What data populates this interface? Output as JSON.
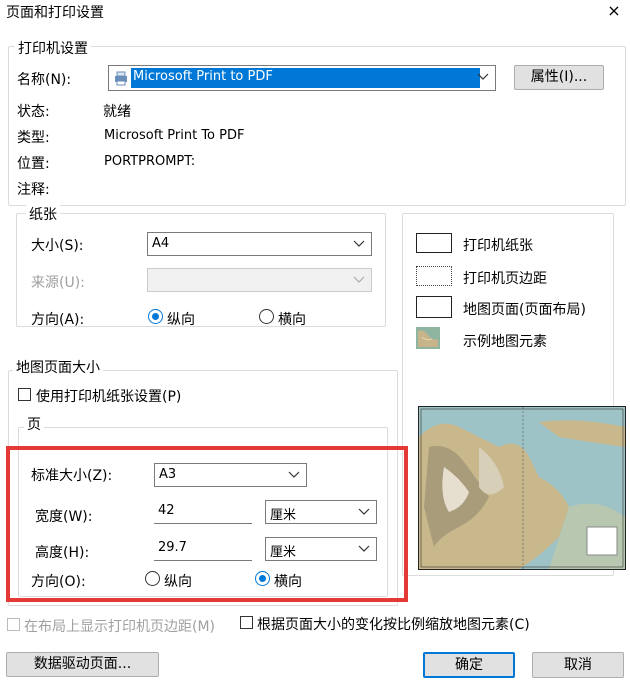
{
  "window": {
    "title": "页面和打印设置",
    "close_glyph": "×"
  },
  "printer": {
    "group_label": "打印机设置",
    "name_label": "名称(N):",
    "name_value": "Microsoft Print to PDF",
    "properties_button": "属性(I)...",
    "status_label": "状态:",
    "status_value": "就绪",
    "type_label": "类型:",
    "type_value": "Microsoft Print To PDF",
    "location_label": "位置:",
    "location_value": "PORTPROMPT:",
    "comment_label": "注释:"
  },
  "paper": {
    "group_label": "纸张",
    "size_label": "大小(S):",
    "size_value": "A4",
    "source_label": "来源(U):",
    "source_value": "",
    "orientation_label": "方向(A):",
    "portrait_label": "纵向",
    "landscape_label": "横向",
    "orientation_selected": "portrait"
  },
  "legend": {
    "items": [
      {
        "label": "打印机纸张",
        "style": "solid"
      },
      {
        "label": "打印机页边距",
        "style": "dotted"
      },
      {
        "label": "地图页面(页面布局)",
        "style": "solid"
      },
      {
        "label": "示例地图元素",
        "style": "map"
      }
    ]
  },
  "map_page": {
    "group_label": "地图页面大小",
    "use_printer_paper_label": "使用打印机纸张设置(P)",
    "use_printer_paper_checked": false,
    "page_group_label": "页",
    "standard_size_label": "标准大小(Z):",
    "standard_size_value": "A3",
    "width_label": "宽度(W):",
    "width_value": "42",
    "width_unit": "厘米",
    "height_label": "高度(H):",
    "height_value": "29.7",
    "height_unit": "厘米",
    "orientation_label": "方向(O):",
    "portrait_label": "纵向",
    "landscape_label": "横向",
    "orientation_selected": "landscape"
  },
  "options": {
    "show_margins_label": "在布局上显示打印机页边距(M)",
    "show_margins_enabled": false,
    "scale_elements_label": "根据页面大小的变化按比例缩放地图元素(C)",
    "scale_elements_checked": false
  },
  "footer": {
    "data_driven_button": "数据驱动页面...",
    "ok_button": "确定",
    "cancel_button": "取消"
  },
  "colors": {
    "accent": "#0078d7",
    "highlight": "#e53935",
    "selection": "#0078d7"
  }
}
